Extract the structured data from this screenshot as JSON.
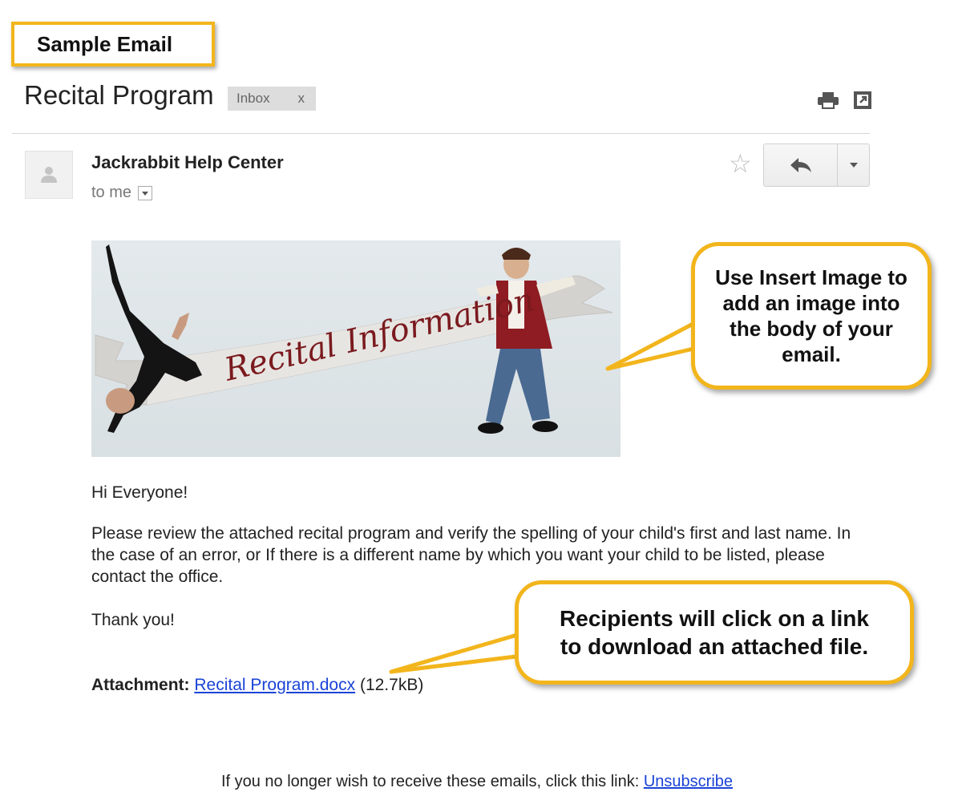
{
  "label": "Sample Email",
  "email": {
    "subject": "Recital Program",
    "tag": "Inbox",
    "tag_close": "x",
    "sender": "Jackrabbit Help Center",
    "recipient": "to me",
    "banner_text": "Recital Information",
    "greeting": "Hi Everyone!",
    "paragraph": "Please review the attached recital program and verify the spelling of your child's first and last name. In the case of an error, or If there is a different name by which you want your child to be listed, please contact the office.",
    "thanks": "Thank you!",
    "attachment_label": "Attachment:",
    "attachment_name": "Recital Program.docx",
    "attachment_size": "(12.7kB)",
    "footer_text": "If you no longer wish to receive these emails, click this link:",
    "unsubscribe": "Unsubscribe"
  },
  "icons": {
    "print": "printer-icon",
    "popout": "popout-icon",
    "avatar": "person-icon",
    "star": "star-icon",
    "reply": "reply-icon",
    "more": "caret-down-icon"
  },
  "callouts": {
    "image": "Use Insert Image to add an image into the body of your email.",
    "attachment": "Recipients will click on a link to download an attached file."
  },
  "colors": {
    "accent": "#f2b51c",
    "link": "#1a43d6",
    "banner_text": "#7a1a1e"
  }
}
